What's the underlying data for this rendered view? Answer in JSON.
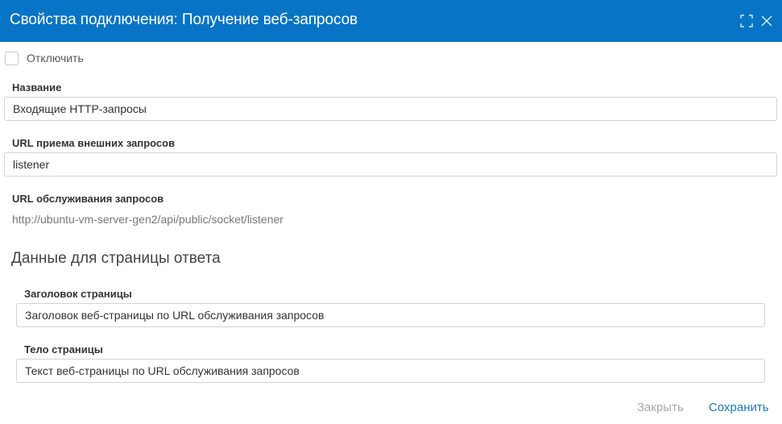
{
  "dialog": {
    "title": "Свойства подключения: Получение веб-запросов"
  },
  "disable": {
    "label": "Отключить",
    "checked": false
  },
  "name_field": {
    "label": "Название",
    "value": "Входящие HTTP-запросы"
  },
  "external_url_field": {
    "label": "URL приема внешних запросов",
    "value": "listener"
  },
  "service_url": {
    "label": "URL обслуживания запросов",
    "value": "http://ubuntu-vm-server-gen2/api/public/socket/listener"
  },
  "response_section": {
    "title": "Данные для страницы ответа",
    "page_title_field": {
      "label": "Заголовок страницы",
      "value": "Заголовок веб-страницы по URL обслуживания запросов"
    },
    "page_body_field": {
      "label": "Тело страницы",
      "value": "Текст веб-страницы по URL обслуживания запросов"
    }
  },
  "footer": {
    "close_label": "Закрыть",
    "save_label": "Сохранить"
  },
  "colors": {
    "titlebar": "#0874c5",
    "primary_link": "#1e78c2",
    "disabled_link": "#a8a8a8"
  },
  "icons": {
    "maximize": "maximize-icon",
    "close": "close-icon"
  }
}
